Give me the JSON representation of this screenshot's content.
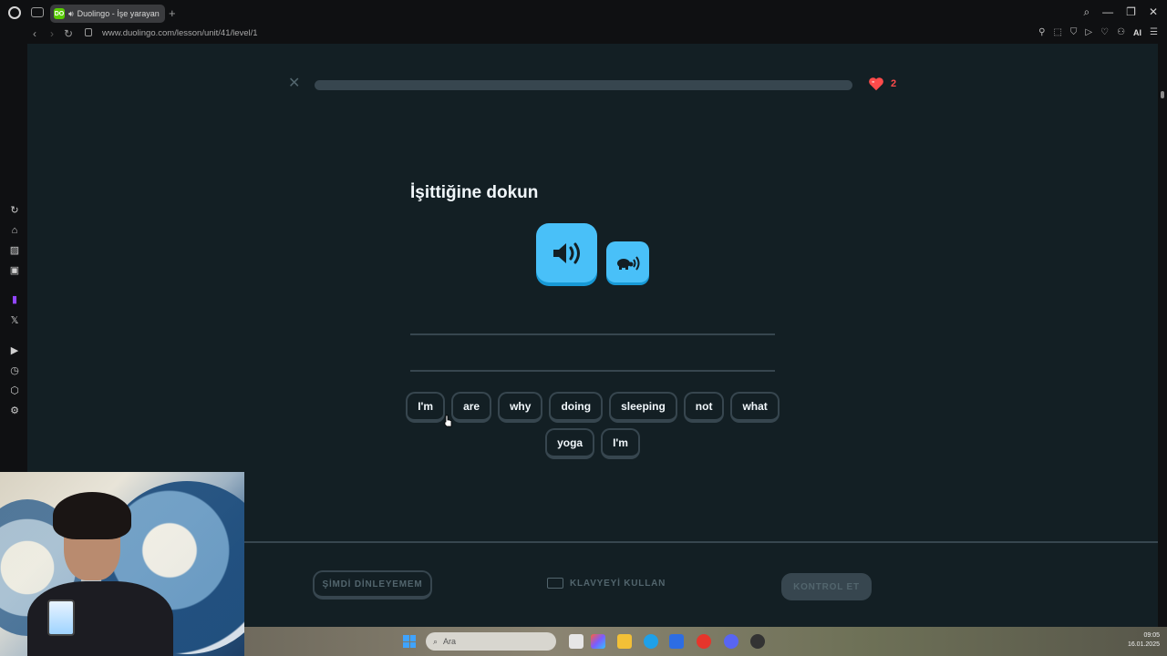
{
  "browser": {
    "tab_title": "Duolingo - İşe yarayan",
    "tab_favicon": "DO",
    "url_domain": "www.duolingo.com",
    "url_path": "/lesson/unit/41/level/1",
    "toolbar_ai": "AI"
  },
  "lesson": {
    "progress_fraction": 0.0,
    "hearts": "2",
    "prompt": "İşittiğine dokun",
    "words_row1": [
      "I'm",
      "are",
      "why",
      "doing",
      "sleeping",
      "not",
      "what"
    ],
    "words_row2": [
      "yoga",
      "I'm"
    ],
    "skip_label": "ŞİMDİ DİNLEYEMEM",
    "keyboard_label": "KLAVYEYİ KULLAN",
    "check_label": "KONTROL ET"
  },
  "taskbar": {
    "search_placeholder": "Ara",
    "time": "09:05",
    "date": "16.01.2025"
  },
  "colors": {
    "page_bg": "#131f24",
    "border": "#37464f",
    "speaker": "#49c0f8",
    "heart": "#ff4b4b",
    "progress_fill": "#58cc02"
  }
}
